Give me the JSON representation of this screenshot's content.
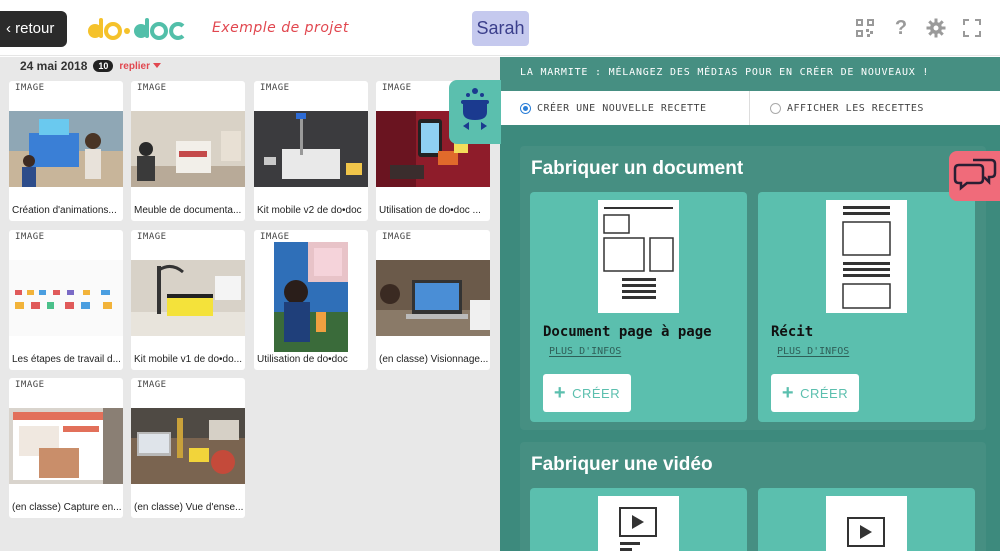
{
  "topbar": {
    "back_label": "‹ retour",
    "project_title": "Exemple de projet",
    "user_name": "Sarah",
    "icons": [
      "qr-code-icon",
      "help-icon",
      "settings-icon",
      "fullscreen-icon"
    ],
    "help_glyph": "?"
  },
  "logo": {
    "text": "do•doc",
    "colors": {
      "do": "#f5c22b",
      "doc": "#52bfa9"
    }
  },
  "media": {
    "date": "24 mai 2018",
    "count": "10",
    "fold_label": "replier",
    "items": [
      {
        "type": "IMAGE",
        "caption": "Création d'animations..."
      },
      {
        "type": "IMAGE",
        "caption": "Meuble de documenta..."
      },
      {
        "type": "IMAGE",
        "caption": "Kit mobile v2 de do•doc"
      },
      {
        "type": "IMAGE",
        "caption": "Utilisation de do•doc ..."
      },
      {
        "type": "IMAGE",
        "caption": "Les étapes de travail d..."
      },
      {
        "type": "IMAGE",
        "caption": "Kit mobile v1 de do•do..."
      },
      {
        "type": "IMAGE",
        "caption": "Utilisation de do•doc"
      },
      {
        "type": "IMAGE",
        "caption": "(en classe) Visionnage..."
      },
      {
        "type": "IMAGE",
        "caption": "(en classe) Capture en..."
      },
      {
        "type": "IMAGE",
        "caption": "(en classe) Vue d'ense..."
      }
    ]
  },
  "marmite": {
    "header": "LA MARMITE : MÉLANGEZ DES MÉDIAS POUR EN CRÉER DE NOUVEAUX !",
    "modes": [
      {
        "label": "CRÉER UNE NOUVELLE RECETTE",
        "selected": true
      },
      {
        "label": "AFFICHER LES RECETTES",
        "selected": false
      }
    ],
    "sections": [
      {
        "title": "Fabriquer un document",
        "recipes": [
          {
            "name": "Document page à page",
            "more_label": "PLUS D'INFOS",
            "create_label": "CRÉER"
          },
          {
            "name": "Récit",
            "more_label": "PLUS D'INFOS",
            "create_label": "CRÉER"
          }
        ]
      },
      {
        "title": "Fabriquer une vidéo",
        "recipes": []
      }
    ]
  },
  "colors": {
    "accent_red": "#e1474f",
    "teal_dark": "#3d8a7d",
    "teal_card": "#5bbfae",
    "user_badge": "#c5c9ee",
    "chat_pink": "#f06b7a"
  }
}
